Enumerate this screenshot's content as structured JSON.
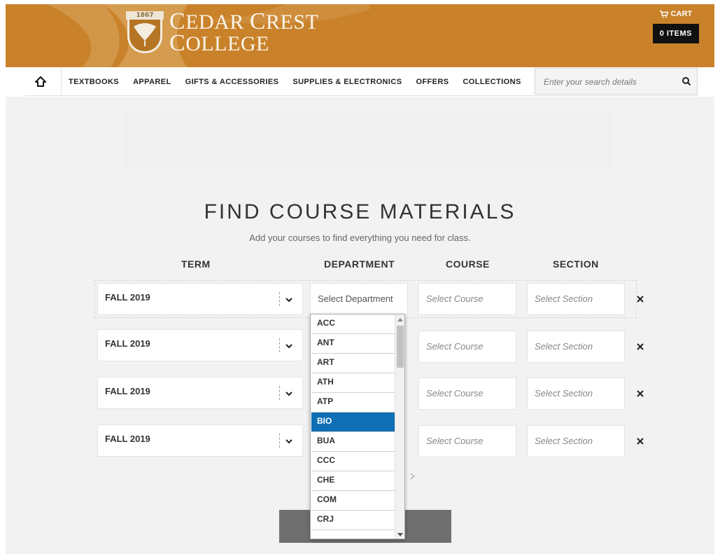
{
  "header": {
    "logo": {
      "year": "1867",
      "line1_cap": "C",
      "line1_rest": "EDAR ",
      "line1_cap2": "C",
      "line1_rest2": "REST",
      "line2_cap": "C",
      "line2_rest": "OLLEGE"
    },
    "cart_label": "CART",
    "cart_items": "0 ITEMS",
    "brand_color": "#c9822a"
  },
  "nav": {
    "items": [
      "TEXTBOOKS",
      "APPAREL",
      "GIFTS & ACCESSORIES",
      "SUPPLIES & ELECTRONICS",
      "OFFERS",
      "COLLECTIONS"
    ],
    "search_placeholder": "Enter your search details"
  },
  "page": {
    "title": "FIND COURSE MATERIALS",
    "subtitle": "Add your courses to find everything you need for class.",
    "columns": {
      "term": "TERM",
      "department": "DEPARTMENT",
      "course": "COURSE",
      "section": "SECTION"
    }
  },
  "rows": [
    {
      "term": "FALL 2019",
      "department": "Select Department",
      "course": "Select Course",
      "section": "Select Section"
    },
    {
      "term": "FALL 2019",
      "department": "",
      "course": "Select Course",
      "section": "Select Section"
    },
    {
      "term": "FALL 2019",
      "department": "",
      "course": "Select Course",
      "section": "Select Section"
    },
    {
      "term": "FALL 2019",
      "department": "",
      "course": "Select Course",
      "section": "Select Section"
    }
  ],
  "department_options": [
    "ACC",
    "ANT",
    "ART",
    "ATH",
    "ATP",
    "BIO",
    "BUA",
    "CCC",
    "CHE",
    "COM",
    "CRJ"
  ],
  "department_selected_highlight": "BIO",
  "highlight_color": "#0e6fb4"
}
